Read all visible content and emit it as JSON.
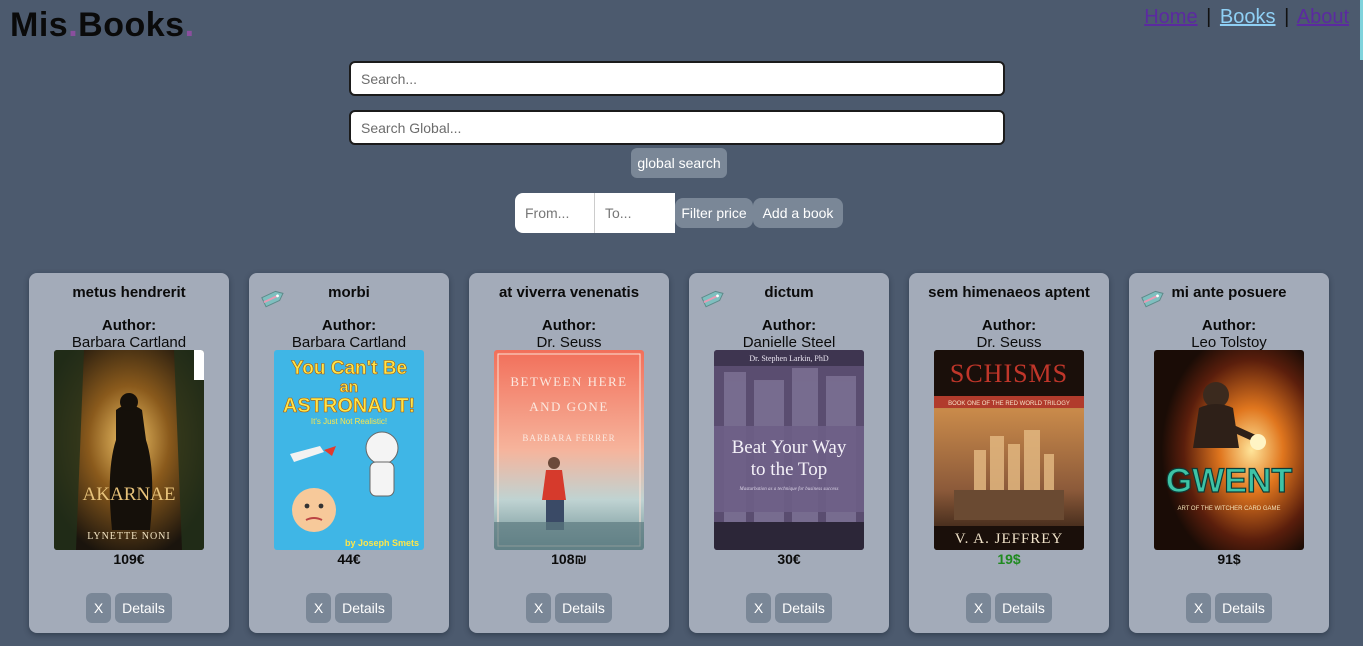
{
  "logo": {
    "part1": "Mis",
    "dot1": ".",
    "part2": "Books",
    "dot2": "."
  },
  "nav": {
    "items": [
      {
        "label": "Home"
      },
      {
        "label": "Books"
      },
      {
        "label": "About"
      }
    ],
    "separator": "|"
  },
  "search": {
    "local_placeholder": "Search...",
    "global_placeholder": "Search Global...",
    "global_button": "global search"
  },
  "filter": {
    "from_placeholder": "From...",
    "to_placeholder": "To...",
    "filter_button": "Filter price",
    "add_button": "Add a book"
  },
  "card_labels": {
    "author_label": "Author:",
    "delete": "X",
    "details": "Details"
  },
  "books": [
    {
      "title": "metus hendrerit",
      "author": "Barbara Cartland",
      "price": "109€",
      "sale": false,
      "cover": {
        "text": [
          "AKARNAE",
          "LYNETTE NONI"
        ],
        "icon": "akarnae-cover"
      }
    },
    {
      "title": "morbi",
      "author": "Barbara Cartland",
      "price": "44€",
      "sale": true,
      "cover": {
        "text": [
          "You Can't Be",
          "an",
          "ASTRONAUT!",
          "It's Just Not Realistic!",
          "by Joseph Smets"
        ],
        "icon": "astronaut-cover"
      }
    },
    {
      "title": "at viverra venenatis",
      "author": "Dr. Seuss",
      "price": "108₪",
      "sale": false,
      "cover": {
        "text": [
          "BETWEEN HERE",
          "AND GONE",
          "BARBARA FERRER"
        ],
        "icon": "between-here-cover"
      }
    },
    {
      "title": "dictum",
      "author": "Danielle Steel",
      "price": "30€",
      "sale": true,
      "cover": {
        "text": [
          "Dr. Stephen Larkin, PhD",
          "Beat Your Way",
          "to the Top",
          "Masturbation as a technique for business success"
        ],
        "icon": "beat-your-way-cover"
      }
    },
    {
      "title": "sem himenaeos aptent",
      "author": "Dr. Seuss",
      "price": "19$",
      "sale": false,
      "price_color": "#1f8a1f",
      "cover": {
        "text": [
          "SCHISMS",
          "BOOK ONE OF THE RED WORLD TRILOGY",
          "V. A. JEFFREY"
        ],
        "icon": "schisms-cover"
      }
    },
    {
      "title": "mi ante posuere",
      "author": "Leo Tolstoy",
      "price": "91$",
      "sale": true,
      "cover": {
        "text": [
          "GWENT",
          "ART OF THE WITCHER CARD GAME"
        ],
        "icon": "gwent-cover"
      }
    }
  ],
  "colors": {
    "background": "#4c5a6e",
    "card": "#a3abb9",
    "button": "#7a8797",
    "nav_link": "#5b2aa0",
    "nav_active": "#8fd0f5",
    "logo_dot": "#8a4f9e"
  }
}
